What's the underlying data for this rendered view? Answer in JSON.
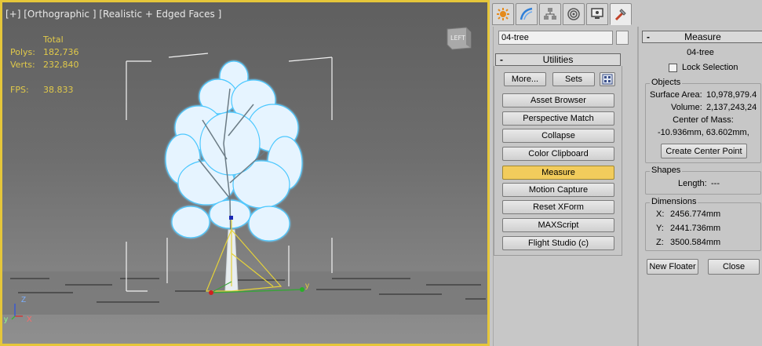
{
  "viewport": {
    "label": "[+] [Orthographic ] [Realistic + Edged Faces ]",
    "stats": {
      "header": "Total",
      "polys_label": "Polys:",
      "polys_value": "182,736",
      "verts_label": "Verts:",
      "verts_value": "232,840",
      "fps_label": "FPS:",
      "fps_value": "38.833"
    },
    "viewcube_label": "LEFT",
    "axis_labels": {
      "z": "Z",
      "x": "X",
      "y": "y"
    }
  },
  "command_panel": {
    "tabs": [
      {
        "icon": "create-icon"
      },
      {
        "icon": "modify-icon"
      },
      {
        "icon": "hierarchy-icon"
      },
      {
        "icon": "motion-icon"
      },
      {
        "icon": "display-icon"
      },
      {
        "icon": "utilities-icon"
      }
    ],
    "object_name": "04-tree",
    "utilities": {
      "title": "Utilities",
      "collapse": "-",
      "more_label": "More...",
      "sets_label": "Sets",
      "buttons": [
        "Asset Browser",
        "Perspective Match",
        "Collapse",
        "Color Clipboard",
        "Measure",
        "Motion Capture",
        "Reset XForm",
        "MAXScript",
        "Flight Studio (c)"
      ],
      "active_button": "Measure"
    }
  },
  "measure": {
    "title": "Measure",
    "collapse": "-",
    "object_name": "04-tree",
    "lock_selection": "Lock Selection",
    "objects_title": "Objects",
    "surface_area_label": "Surface Area:",
    "surface_area_value": "10,978,979.4",
    "volume_label": "Volume:",
    "volume_value": "2,137,243,24",
    "center_of_mass_label": "Center of Mass:",
    "center_of_mass_value": "-10.936mm, 63.602mm,",
    "create_center_point": "Create Center Point",
    "shapes_title": "Shapes",
    "length_label": "Length:",
    "length_value": "---",
    "dimensions_title": "Dimensions",
    "x_label": "X:",
    "x_value": "2456.774mm",
    "y_label": "Y:",
    "y_value": "2441.736mm",
    "z_label": "Z:",
    "z_value": "3500.584mm",
    "new_floater": "New Floater",
    "close": "Close"
  },
  "colors": {
    "active_viewport_border": "#e5c63a",
    "active_button": "#f2cc5c",
    "stats_text": "#e0c94a",
    "foliage": "#e6f4ff"
  }
}
